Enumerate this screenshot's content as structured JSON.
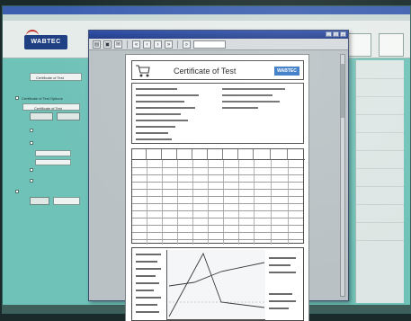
{
  "app": {
    "header": {
      "logo_text": "WABTEC"
    },
    "side_panel": {
      "title_field": "Certificate of Test",
      "section_label": "Certificate of Test Options",
      "dropdown_label": "Certificate of Test"
    }
  },
  "preview": {
    "certificate": {
      "title": "Certificate of Test",
      "logo_text": "WABTEC"
    }
  },
  "colors": {
    "desktop_teal": "#6fc2b8",
    "titlebar_blue": "#2c4ea8",
    "brand_blue": "#1e3f82",
    "cert_logo_blue": "#2f73c4"
  },
  "icons": [
    "print-icon",
    "save-icon",
    "email-icon",
    "first-page-icon",
    "prev-page-icon",
    "next-page-icon",
    "last-page-icon",
    "zoom-icon",
    "shopping-cart-icon"
  ]
}
